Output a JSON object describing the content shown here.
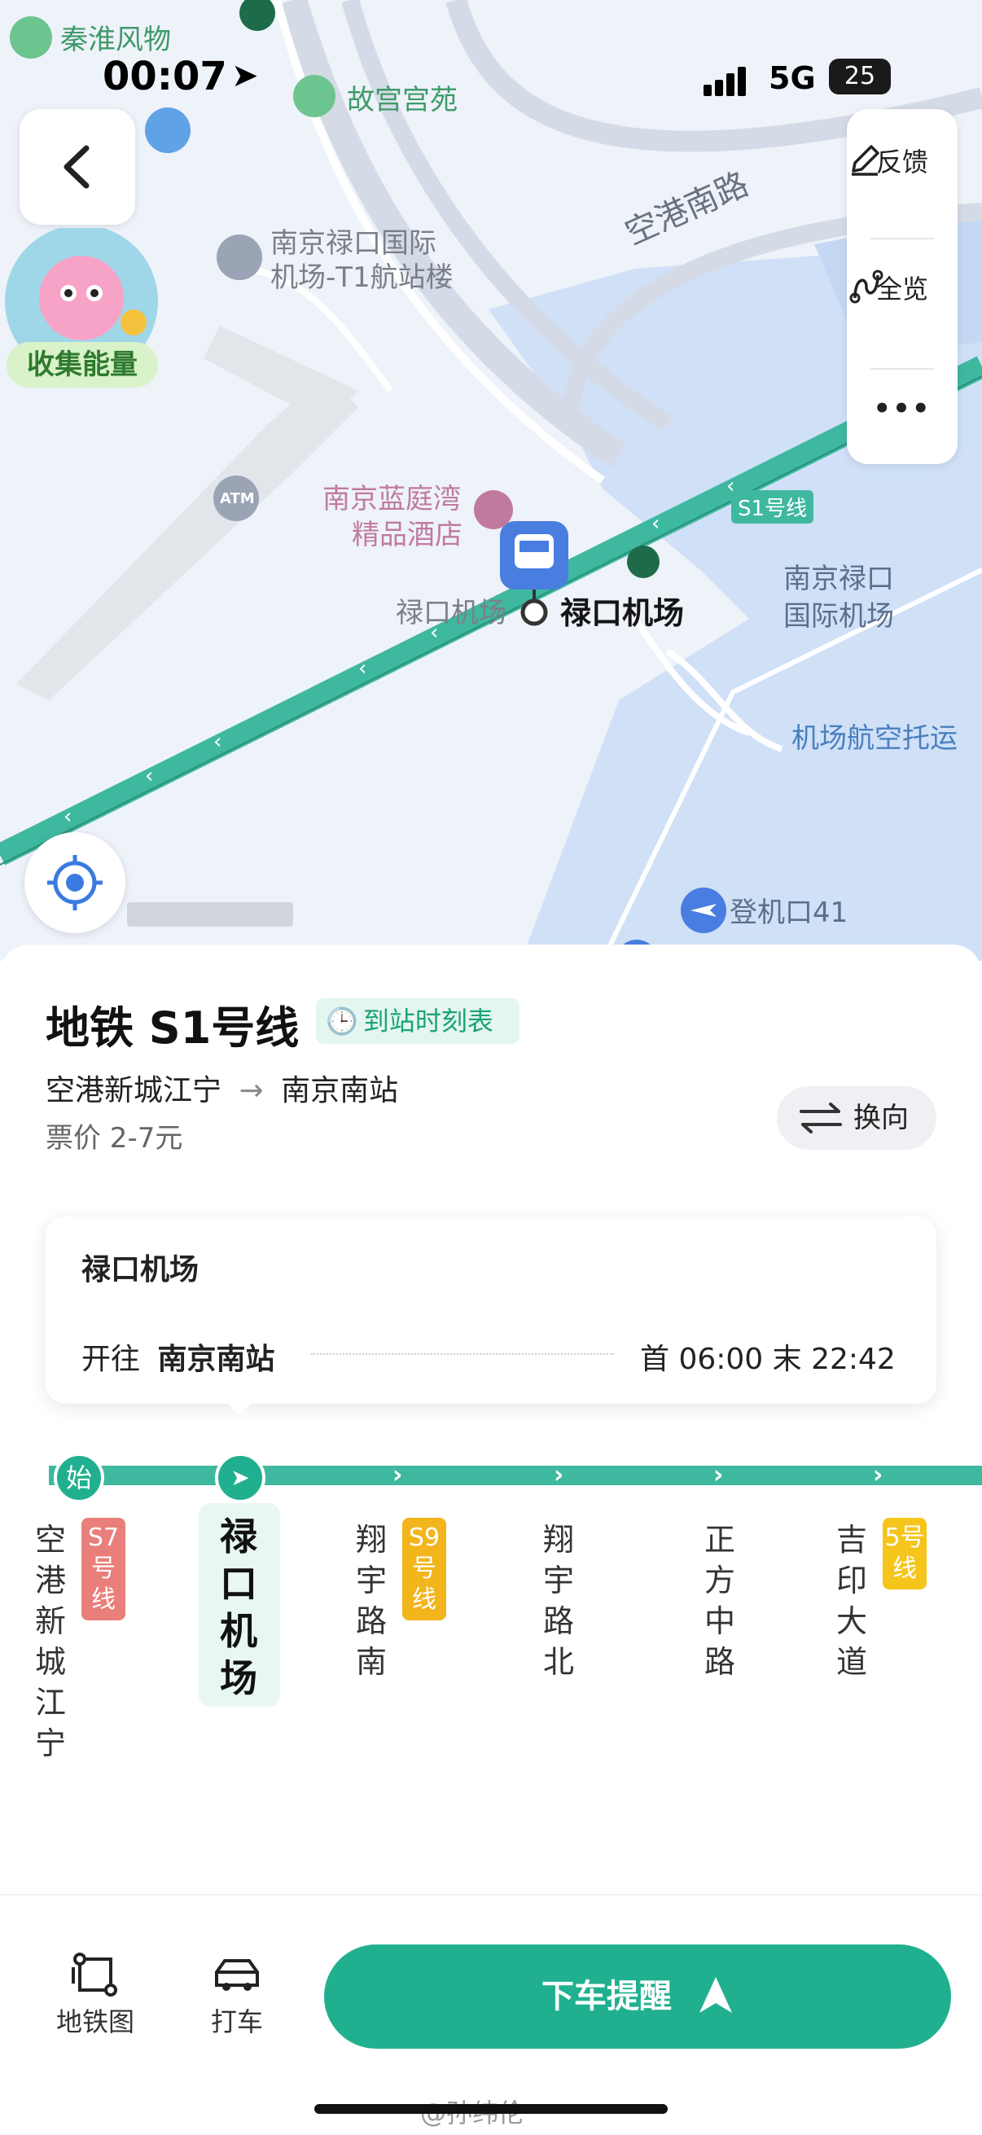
{
  "status_bar": {
    "time": "00:07",
    "network": "5G",
    "battery": "25"
  },
  "map": {
    "labels": {
      "qinhuai": "秦淮风物",
      "gugong": "故宫宫苑",
      "t1_line1": "南京禄口国际",
      "t1_line2": "机场-T1航站楼",
      "konggang_road": "空港南路",
      "hotel_line1": "南京蓝庭湾",
      "hotel_line2": "精品酒店",
      "s1_tag": "S1号线",
      "station_label_gray": "禄口机场",
      "station_label_bold": "禄口机场",
      "airport_line1": "南京禄口",
      "airport_line2": "国际机场",
      "consign": "机场航空托运",
      "gate": "登机口41",
      "atm": "ATM"
    },
    "controls": {
      "feedback": "反馈",
      "overview": "全览",
      "more": "•••",
      "energy": "收集能量"
    },
    "colors": {
      "line": "#3fb8a0",
      "background": "#eef2f9",
      "water": "#cfe0f7"
    }
  },
  "line": {
    "title": "地铁 S1号线",
    "timetable": "到站时刻表",
    "from": "空港新城江宁",
    "arrow": "→",
    "to": "南京南站",
    "fare": "票价 2-7元",
    "reverse": "换向"
  },
  "card": {
    "station": "禄口机场",
    "toward_prefix": "开往",
    "toward_station": "南京南站",
    "first_last": "首 06:00  末 22:42"
  },
  "route": {
    "start_badge": "始",
    "stations": [
      {
        "name": "空港新城江宁",
        "transfer": "S7号线",
        "transfer_color": "#e87f7a"
      },
      {
        "name": "禄口机场",
        "current": true
      },
      {
        "name": "翔宇路南",
        "transfer": "S9号线",
        "transfer_color": "#f2b51c"
      },
      {
        "name": "翔宇路北"
      },
      {
        "name": "正方中路"
      },
      {
        "name": "吉印大道",
        "transfer": "5号线",
        "transfer_color": "#f5c51b"
      }
    ]
  },
  "bottom": {
    "metro_map": "地铁图",
    "taxi": "打车",
    "alight": "下车提醒",
    "accent": "#21b08f"
  },
  "watermark": "@孙纬伦"
}
